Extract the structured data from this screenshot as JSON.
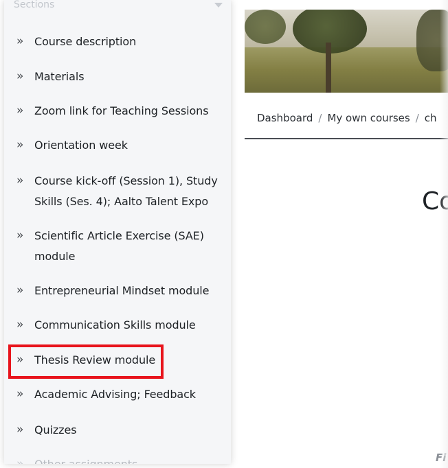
{
  "sidebar": {
    "header": "Sections",
    "items": [
      {
        "label_lines": [
          "Course description"
        ],
        "selected": false
      },
      {
        "label_lines": [
          "Materials"
        ],
        "selected": false
      },
      {
        "label_lines": [
          "Zoom link for Teaching Sessions"
        ],
        "selected": false
      },
      {
        "label_lines": [
          "Orientation week"
        ],
        "selected": false
      },
      {
        "label_lines": [
          "Course kick-off (Session 1), Study",
          "Skills (Ses. 4); Aalto Talent Expo"
        ],
        "selected": false
      },
      {
        "label_lines": [
          "Scientific Article Exercise (SAE)",
          "module"
        ],
        "selected": false
      },
      {
        "label_lines": [
          "Entrepreneurial Mindset module"
        ],
        "selected": false
      },
      {
        "label_lines": [
          "Communication Skills module"
        ],
        "selected": false
      },
      {
        "label_lines": [
          "Thesis Review module"
        ],
        "selected": true
      },
      {
        "label_lines": [
          "Academic Advising; Feedback"
        ],
        "selected": false
      },
      {
        "label_lines": [
          "Quizzes"
        ],
        "selected": false
      },
      {
        "label_lines": [
          "Other assignments"
        ],
        "selected": false
      }
    ],
    "chevron_glyph": "»",
    "highlight_color": "#e8141c"
  },
  "breadcrumb": {
    "items": [
      "Dashboard",
      "My own courses",
      "ch"
    ],
    "separator": "/"
  },
  "main": {
    "title_fragment": "Co",
    "footer_fragment": "Fi"
  },
  "colors": {
    "sidebar_bg": "#f5f6f8",
    "text": "#1d2125",
    "highlight": "#e8141c"
  }
}
